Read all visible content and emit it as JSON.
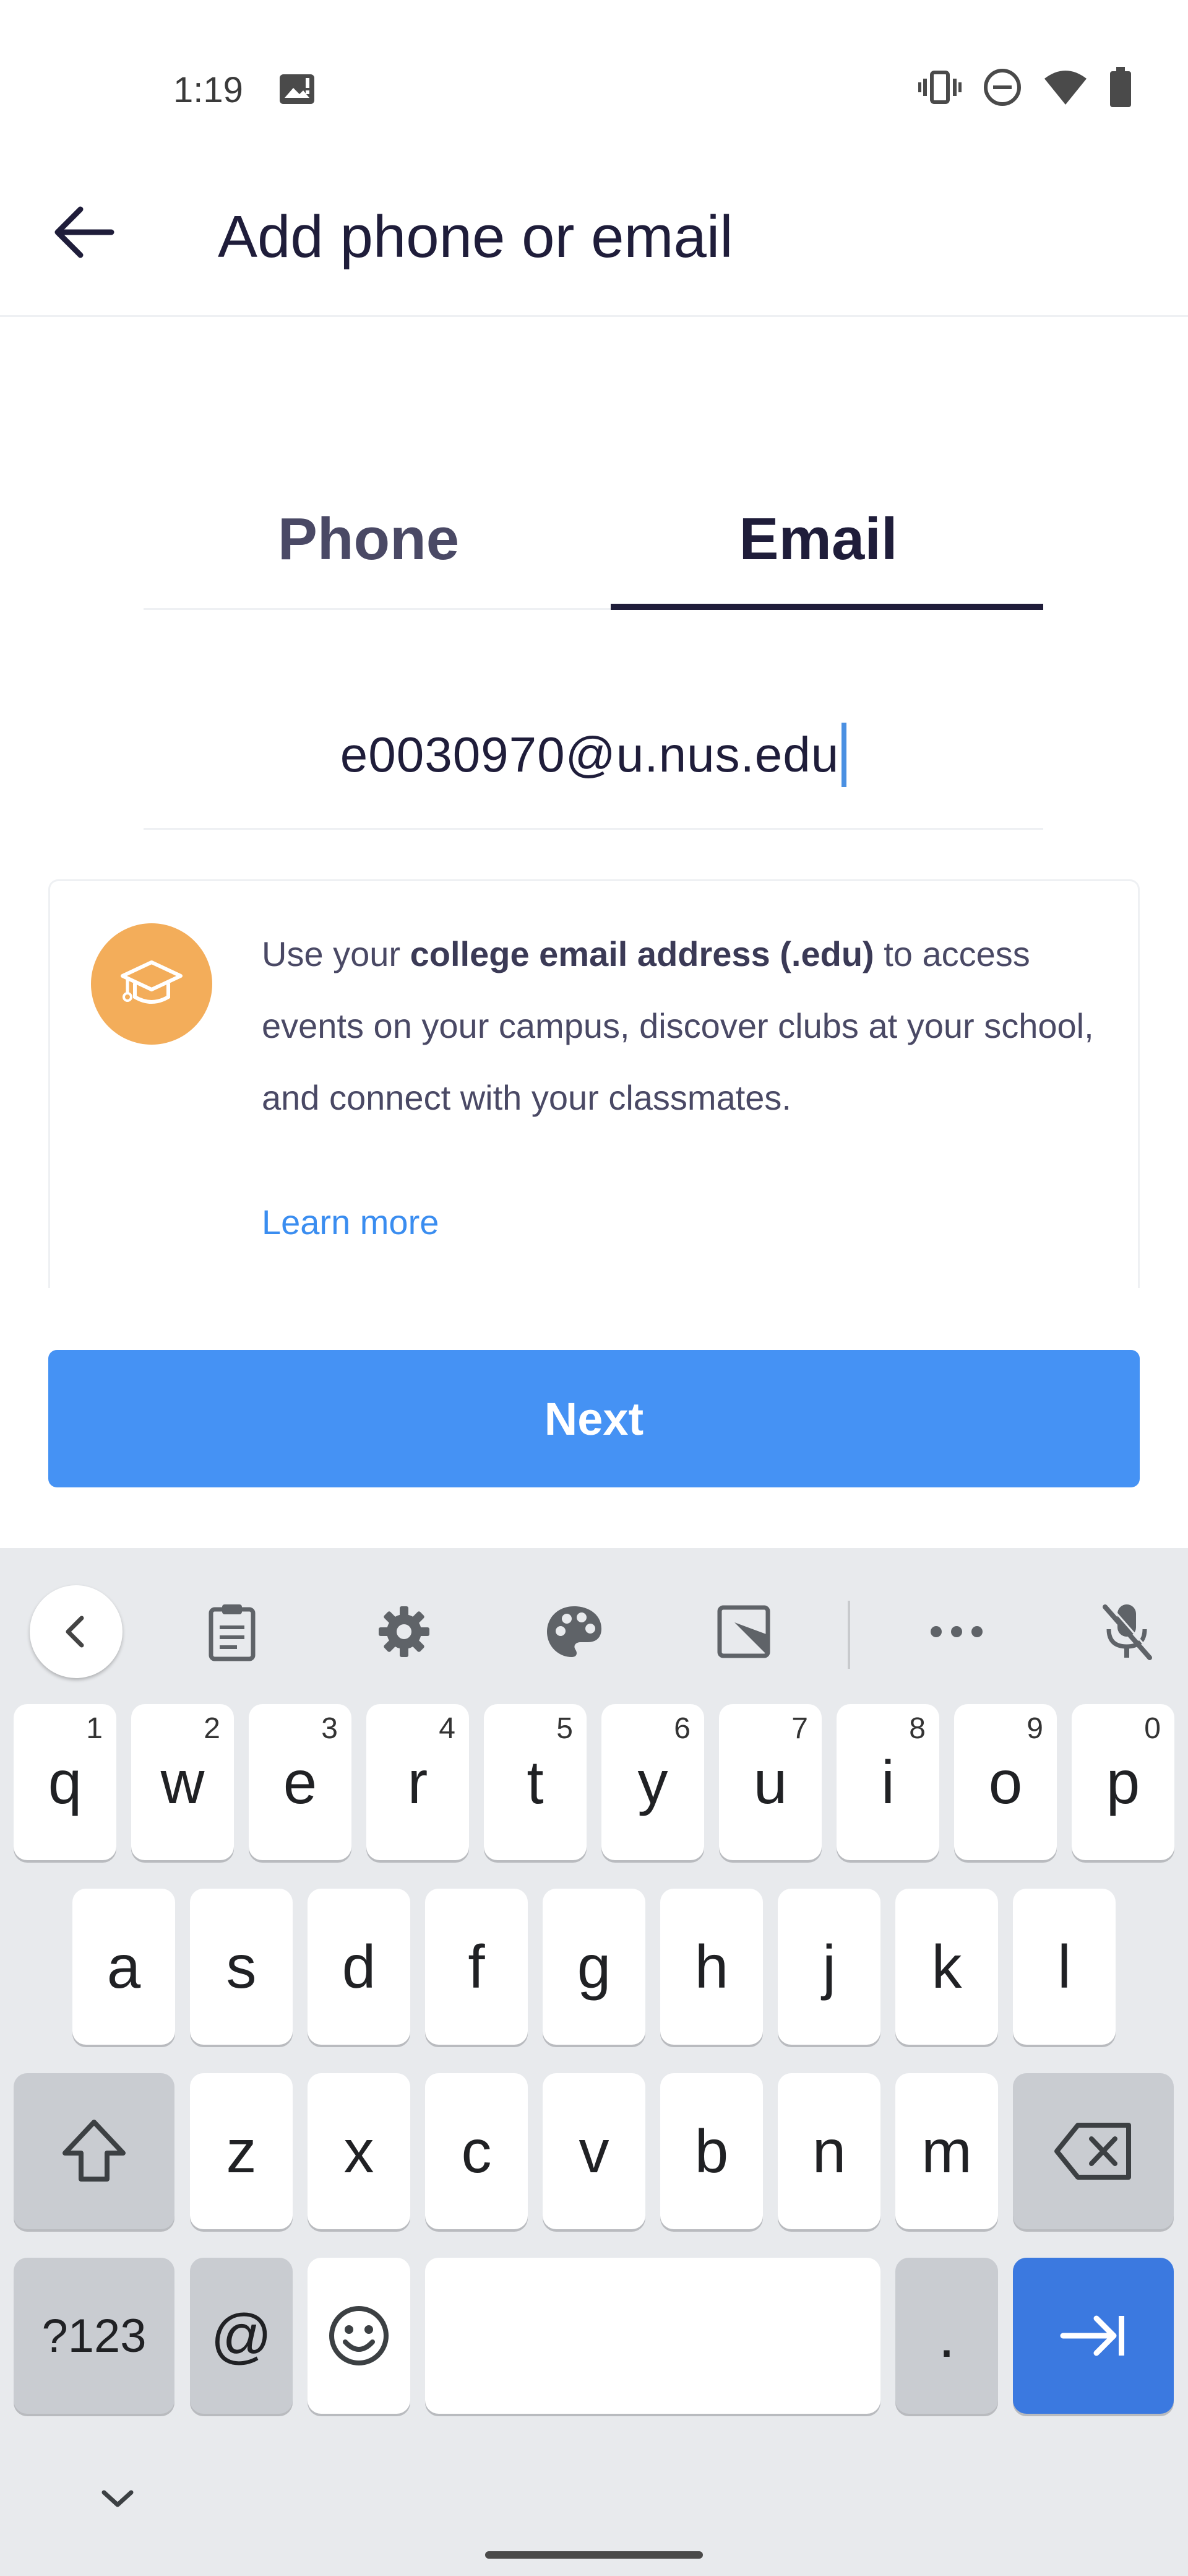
{
  "status_bar": {
    "time": "1:19"
  },
  "app_bar": {
    "title": "Add phone or email"
  },
  "tabs": [
    {
      "label": "Phone",
      "active": false
    },
    {
      "label": "Email",
      "active": true
    }
  ],
  "email_input": {
    "value": "e0030970@u.nus.edu"
  },
  "info_card": {
    "text_prefix": "Use your ",
    "text_bold": "college email address (.edu)",
    "text_suffix": " to access events on your campus, discover clubs at your school, and connect with your classmates.",
    "learn_more": "Learn more",
    "icon": "graduation-cap-icon",
    "icon_color": "#F3AD5A"
  },
  "next_button": {
    "label": "Next",
    "color": "#4592F4"
  },
  "keyboard": {
    "row1": [
      {
        "char": "q",
        "hint": "1"
      },
      {
        "char": "w",
        "hint": "2"
      },
      {
        "char": "e",
        "hint": "3"
      },
      {
        "char": "r",
        "hint": "4"
      },
      {
        "char": "t",
        "hint": "5"
      },
      {
        "char": "y",
        "hint": "6"
      },
      {
        "char": "u",
        "hint": "7"
      },
      {
        "char": "i",
        "hint": "8"
      },
      {
        "char": "o",
        "hint": "9"
      },
      {
        "char": "p",
        "hint": "0"
      }
    ],
    "row2": [
      "a",
      "s",
      "d",
      "f",
      "g",
      "h",
      "j",
      "k",
      "l"
    ],
    "row3": [
      "z",
      "x",
      "c",
      "v",
      "b",
      "n",
      "m"
    ],
    "symbols_key": "?123",
    "at_key": "@",
    "period_key": "."
  },
  "colors": {
    "primary_text": "#1F1D3A",
    "link": "#3A8DF0",
    "enter_key": "#3B79E0"
  }
}
